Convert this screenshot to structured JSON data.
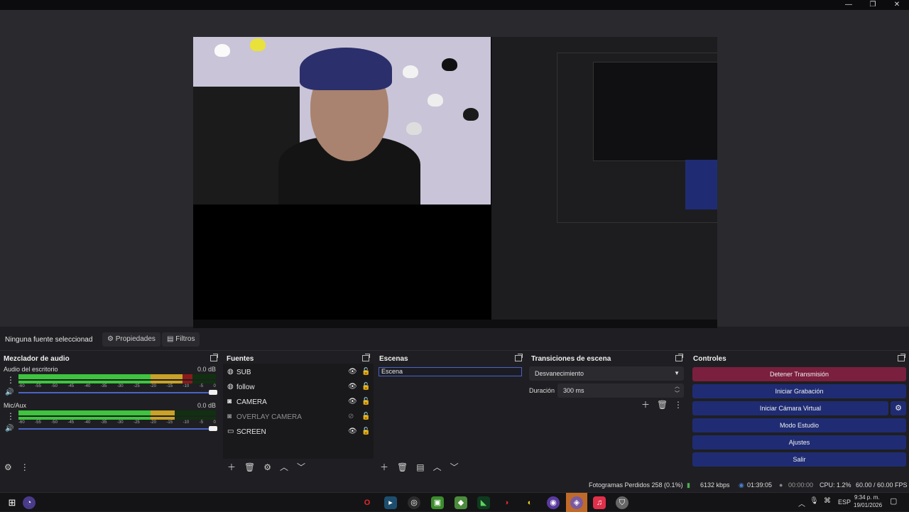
{
  "window": {
    "controls": [
      "—",
      "❐",
      "✕"
    ]
  },
  "properties_bar": {
    "no_source": "Ninguna fuente seleccionad",
    "properties_label": "Propiedades",
    "filters_label": "Filtros"
  },
  "audio_mixer": {
    "title": "Mezclador de audio",
    "channels": [
      {
        "name": "Audio del escritorio",
        "db": "0.0 dB",
        "level": 0.88
      },
      {
        "name": "Mic/Aux",
        "db": "0.0 dB",
        "level": 0.79
      }
    ],
    "scale": [
      "-60",
      "-55",
      "-50",
      "-45",
      "-40",
      "-35",
      "-30",
      "-25",
      "-20",
      "-15",
      "-10",
      "-5",
      "0"
    ]
  },
  "sources": {
    "title": "Fuentes",
    "items": [
      {
        "label": "SUB",
        "icon": "globe-icon",
        "visible": true
      },
      {
        "label": "follow",
        "icon": "globe-icon",
        "visible": true
      },
      {
        "label": "CAMERA",
        "icon": "camera-icon",
        "visible": true
      },
      {
        "label": "OVERLAY CAMERA",
        "icon": "camera-icon",
        "visible": false
      },
      {
        "label": "SCREEN",
        "icon": "monitor-icon",
        "visible": true
      }
    ]
  },
  "scenes": {
    "title": "Escenas",
    "items": [
      "Escena"
    ]
  },
  "transitions": {
    "title": "Transiciones de escena",
    "selected": "Desvanecimiento",
    "duration_label": "Duración",
    "duration_value": "300 ms"
  },
  "controls": {
    "title": "Controles",
    "stop_stream": "Detener Transmisión",
    "start_recording": "Iniciar Grabación",
    "start_virtual_cam": "Iniciar Cámara Virtual",
    "studio_mode": "Modo Estudio",
    "settings": "Ajustes",
    "exit": "Salir",
    "colors": {
      "stop": "#7a1f3d",
      "normal": "#1f2c73"
    }
  },
  "status": {
    "dropped_frames": "Fotogramas Perdidos 258 (0.1%)",
    "bitrate": "6132 kbps",
    "stream_time": "01:39:05",
    "rec_time": "00:00:00",
    "cpu": "CPU: 1.2%",
    "fps": "60.00 / 60.00 FPS"
  },
  "taskbar": {
    "language": "ESP",
    "time": "9:34 p. m.",
    "date": "19/01/2026"
  }
}
